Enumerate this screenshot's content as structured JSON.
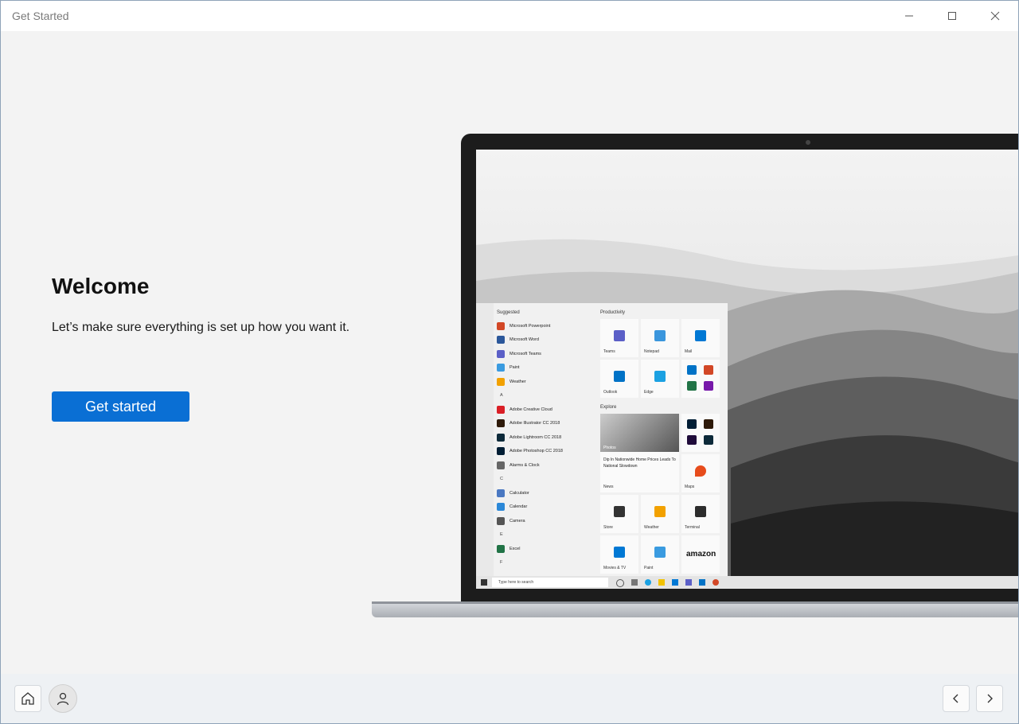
{
  "window": {
    "title": "Get Started",
    "controls": {
      "minimize": "minimize",
      "maximize": "maximize",
      "close": "close"
    }
  },
  "main": {
    "heading": "Welcome",
    "subtitle": "Let’s make sure everything is set up how you want it.",
    "cta_label": "Get started",
    "accent_color": "#0a6fd4"
  },
  "laptop_screen": {
    "start_menu": {
      "suggested_header": "Suggested",
      "apps": [
        {
          "label": "Microsoft Powerpoint",
          "color": "#d24726"
        },
        {
          "label": "Microsoft Word",
          "color": "#2b579a"
        },
        {
          "label": "Microsoft Teams",
          "color": "#5b5fc7"
        },
        {
          "label": "Paint",
          "color": "#3a9be0"
        },
        {
          "label": "Weather",
          "color": "#f2a100"
        },
        {
          "letter": "A"
        },
        {
          "label": "Adobe Creative Cloud",
          "color": "#da1f26"
        },
        {
          "label": "Adobe Illustrator CC 2018",
          "color": "#2e1a0a"
        },
        {
          "label": "Adobe Lightroom CC 2018",
          "color": "#0d2a3a"
        },
        {
          "label": "Adobe Photoshop CC 2018",
          "color": "#001d34"
        },
        {
          "label": "Alarms & Clock",
          "color": "#666666"
        },
        {
          "letter": "C"
        },
        {
          "label": "Calculator",
          "color": "#4a78c2"
        },
        {
          "label": "Calendar",
          "color": "#2b88d8"
        },
        {
          "label": "Camera",
          "color": "#555555"
        },
        {
          "letter": "E"
        },
        {
          "label": "Excel",
          "color": "#217346"
        },
        {
          "letter": "F"
        }
      ],
      "productivity_header": "Productivity",
      "productivity_tiles": [
        {
          "label": "Teams",
          "color": "#5b5fc7"
        },
        {
          "label": "Notepad",
          "color": "#3a96dd"
        },
        {
          "label": "Mail",
          "color": "#0078d4"
        },
        {
          "label": "Outlook",
          "color": "#0072c6"
        },
        {
          "label": "Edge",
          "color": "#1ba1e2"
        }
      ],
      "explore_header": "Explore",
      "news": {
        "photo_label": "Photos",
        "headline": "Dip In Nationwide Home Prices Leads To National Slowdown",
        "source": "News"
      },
      "explore_tiles": [
        {
          "label": "Maps",
          "color": "#e74c1c"
        },
        {
          "label": "Store",
          "color": "#333333"
        },
        {
          "label": "Weather",
          "color": "#f2a100"
        },
        {
          "label": "Terminal",
          "color": "#2d2d2d"
        },
        {
          "label": "Movies & TV",
          "color": "#0078d4"
        },
        {
          "label": "Paint",
          "color": "#3a9be0"
        },
        {
          "label": "amazon",
          "color": "#111111"
        }
      ]
    },
    "taskbar": {
      "search_placeholder": "Type here to search"
    }
  },
  "footer": {
    "home": "home",
    "profile": "profile",
    "back": "back",
    "next": "next"
  }
}
